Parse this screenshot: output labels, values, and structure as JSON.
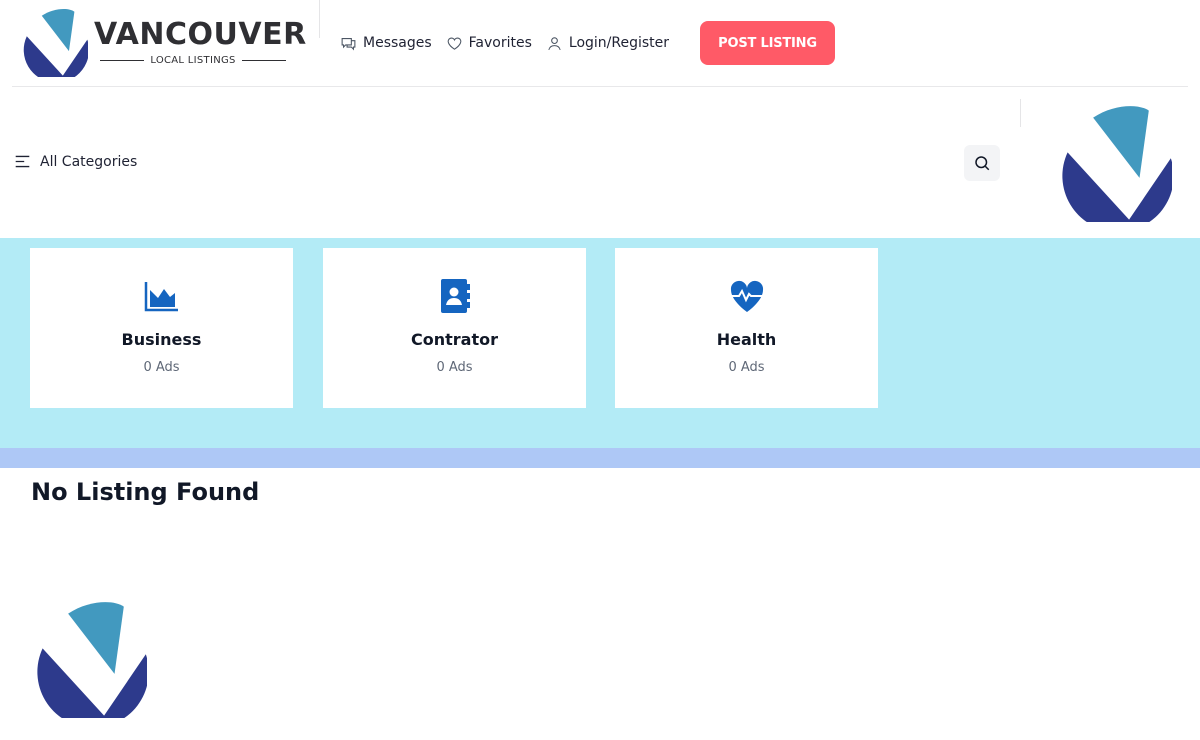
{
  "brand": {
    "name": "VANCOUVER",
    "tagline": "LOCAL LISTINGS",
    "colors": {
      "primary": "#2d3a8c",
      "secondary": "#4299bf"
    }
  },
  "header": {
    "nav": [
      {
        "label": "Messages",
        "icon": "message-icon"
      },
      {
        "label": "Favorites",
        "icon": "heart-icon"
      },
      {
        "label": "Login/Register",
        "icon": "user-icon"
      }
    ],
    "post_button": "POST LISTING",
    "post_button_color": "#ff5a67"
  },
  "subbar": {
    "all_categories": "All Categories",
    "search_icon": "search-icon"
  },
  "categories": [
    {
      "name": "Business",
      "count": "0 Ads",
      "icon": "area-chart-icon"
    },
    {
      "name": "Contrator",
      "count": "0 Ads",
      "icon": "contact-book-icon"
    },
    {
      "name": "Health",
      "count": "0 Ads",
      "icon": "heart-pulse-icon"
    }
  ],
  "listings": {
    "empty_message": "No Listing Found"
  },
  "theme": {
    "band_color": "#b3ebf6",
    "strip_color": "#aec8f6",
    "icon_color": "#1565c0"
  }
}
